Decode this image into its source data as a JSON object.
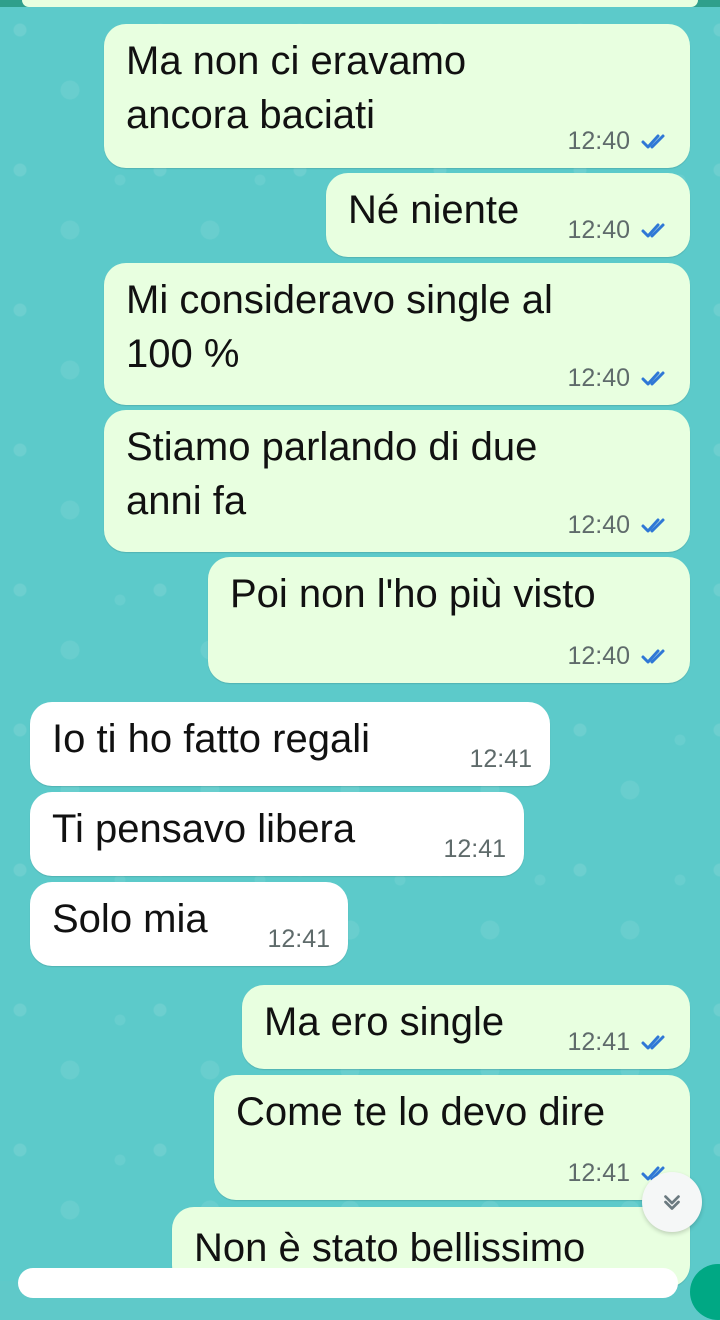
{
  "messages": [
    {
      "direction": "out",
      "text": "Ma non ci eravamo\nancora baciati",
      "time": "12:40",
      "status": "read"
    },
    {
      "direction": "out",
      "text": "Né niente",
      "time": "12:40",
      "status": "read"
    },
    {
      "direction": "out",
      "text": "Mi consideravo single al\n100 %",
      "time": "12:40",
      "status": "read"
    },
    {
      "direction": "out",
      "text": "Stiamo parlando di due\nanni fa",
      "time": "12:40",
      "status": "read"
    },
    {
      "direction": "out",
      "text": "Poi non l'ho più visto",
      "time": "12:40",
      "status": "read"
    },
    {
      "direction": "in",
      "text": "Io ti ho fatto regali",
      "time": "12:41"
    },
    {
      "direction": "in",
      "text": "Ti pensavo libera",
      "time": "12:41"
    },
    {
      "direction": "in",
      "text": "Solo mia",
      "time": "12:41"
    },
    {
      "direction": "out",
      "text": "Ma ero single",
      "time": "12:41",
      "status": "read"
    },
    {
      "direction": "out",
      "text": "Come te lo devo dire",
      "time": "12:41",
      "status": "read"
    },
    {
      "direction": "out",
      "text": "Non è stato bellissimo",
      "time": "",
      "status": ""
    }
  ],
  "ui": {
    "scroll_button_icon": "chevron-double-down-icon",
    "read_tick_icon": "double-check-icon",
    "colors": {
      "outgoing_bubble": "#e8ffe0",
      "incoming_bubble": "#ffffff",
      "wallpaper": "#5ccaca",
      "read_ticks": "#2f78d6",
      "accent": "#00a884"
    }
  }
}
